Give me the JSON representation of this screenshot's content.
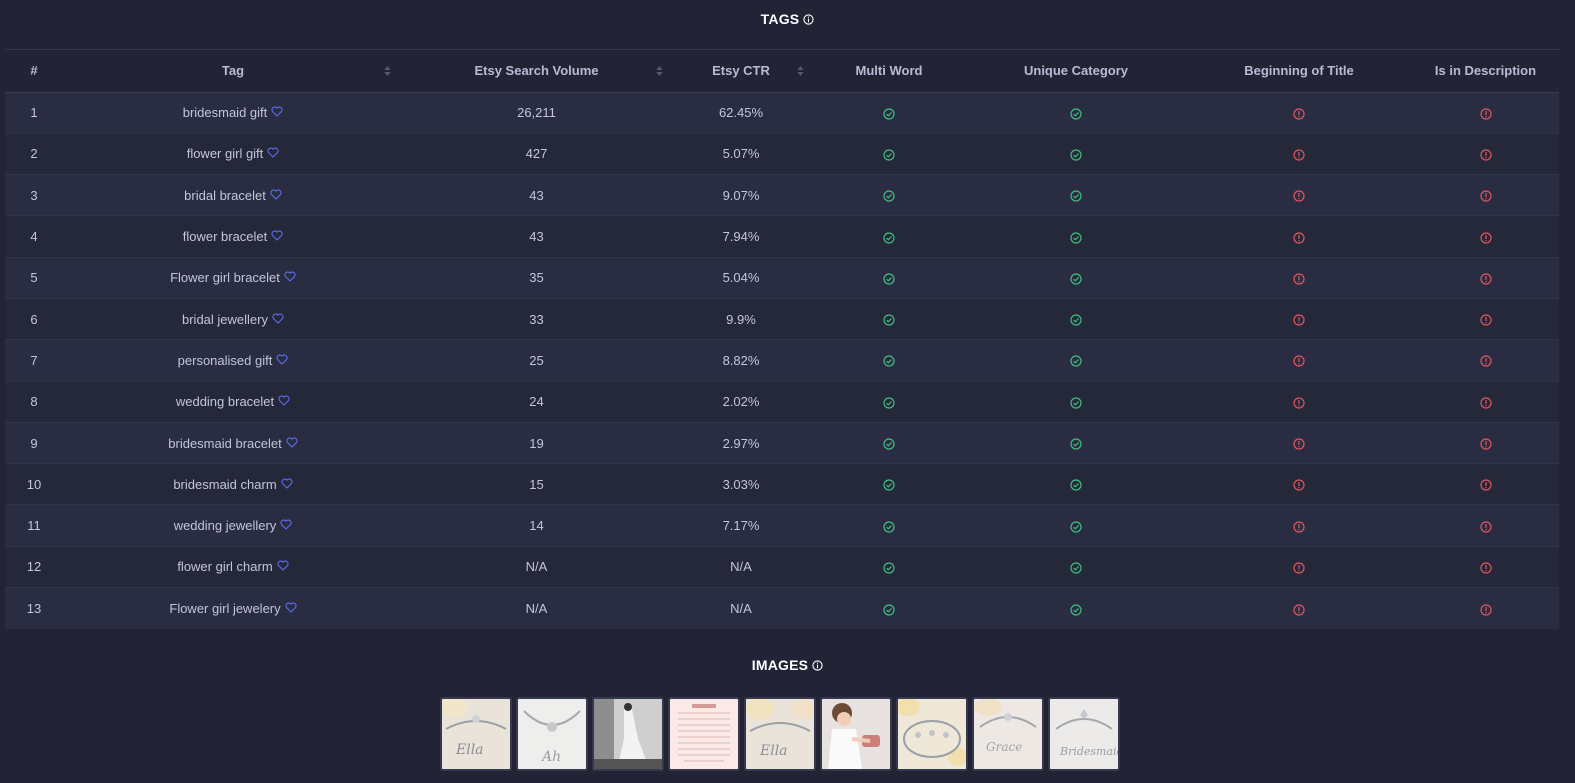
{
  "tags_section": {
    "title": "TAGS"
  },
  "images_section": {
    "title": "IMAGES"
  },
  "columns": [
    "#",
    "Tag",
    "Etsy Search Volume",
    "Etsy CTR",
    "Multi Word",
    "Unique Category",
    "Beginning of Title",
    "Is in Description"
  ],
  "rows": [
    {
      "num": "1",
      "tag": "bridesmaid gift",
      "volume": "26,211",
      "ctr": "62.45%"
    },
    {
      "num": "2",
      "tag": "flower girl gift",
      "volume": "427",
      "ctr": "5.07%"
    },
    {
      "num": "3",
      "tag": "bridal bracelet",
      "volume": "43",
      "ctr": "9.07%"
    },
    {
      "num": "4",
      "tag": "flower bracelet",
      "volume": "43",
      "ctr": "7.94%"
    },
    {
      "num": "5",
      "tag": "Flower girl bracelet",
      "volume": "35",
      "ctr": "5.04%"
    },
    {
      "num": "6",
      "tag": "bridal jewellery",
      "volume": "33",
      "ctr": "9.9%"
    },
    {
      "num": "7",
      "tag": "personalised gift",
      "volume": "25",
      "ctr": "8.82%"
    },
    {
      "num": "8",
      "tag": "wedding bracelet",
      "volume": "24",
      "ctr": "2.02%"
    },
    {
      "num": "9",
      "tag": "bridesmaid bracelet",
      "volume": "19",
      "ctr": "2.97%"
    },
    {
      "num": "10",
      "tag": "bridesmaid charm",
      "volume": "15",
      "ctr": "3.03%"
    },
    {
      "num": "11",
      "tag": "wedding jewellery",
      "volume": "14",
      "ctr": "7.17%"
    },
    {
      "num": "12",
      "tag": "flower girl charm",
      "volume": "N/A",
      "ctr": "N/A"
    },
    {
      "num": "13",
      "tag": "Flower girl jewelery",
      "volume": "N/A",
      "ctr": "N/A"
    }
  ],
  "status": {
    "multi_word": "check",
    "unique_category": "check",
    "beginning_of_title": "alert",
    "is_in_description": "alert"
  },
  "colors": {
    "check": "#3fbf7f",
    "alert": "#e0555f",
    "heart": "#5b6cf0",
    "background": "#222436"
  },
  "image_count": 9
}
